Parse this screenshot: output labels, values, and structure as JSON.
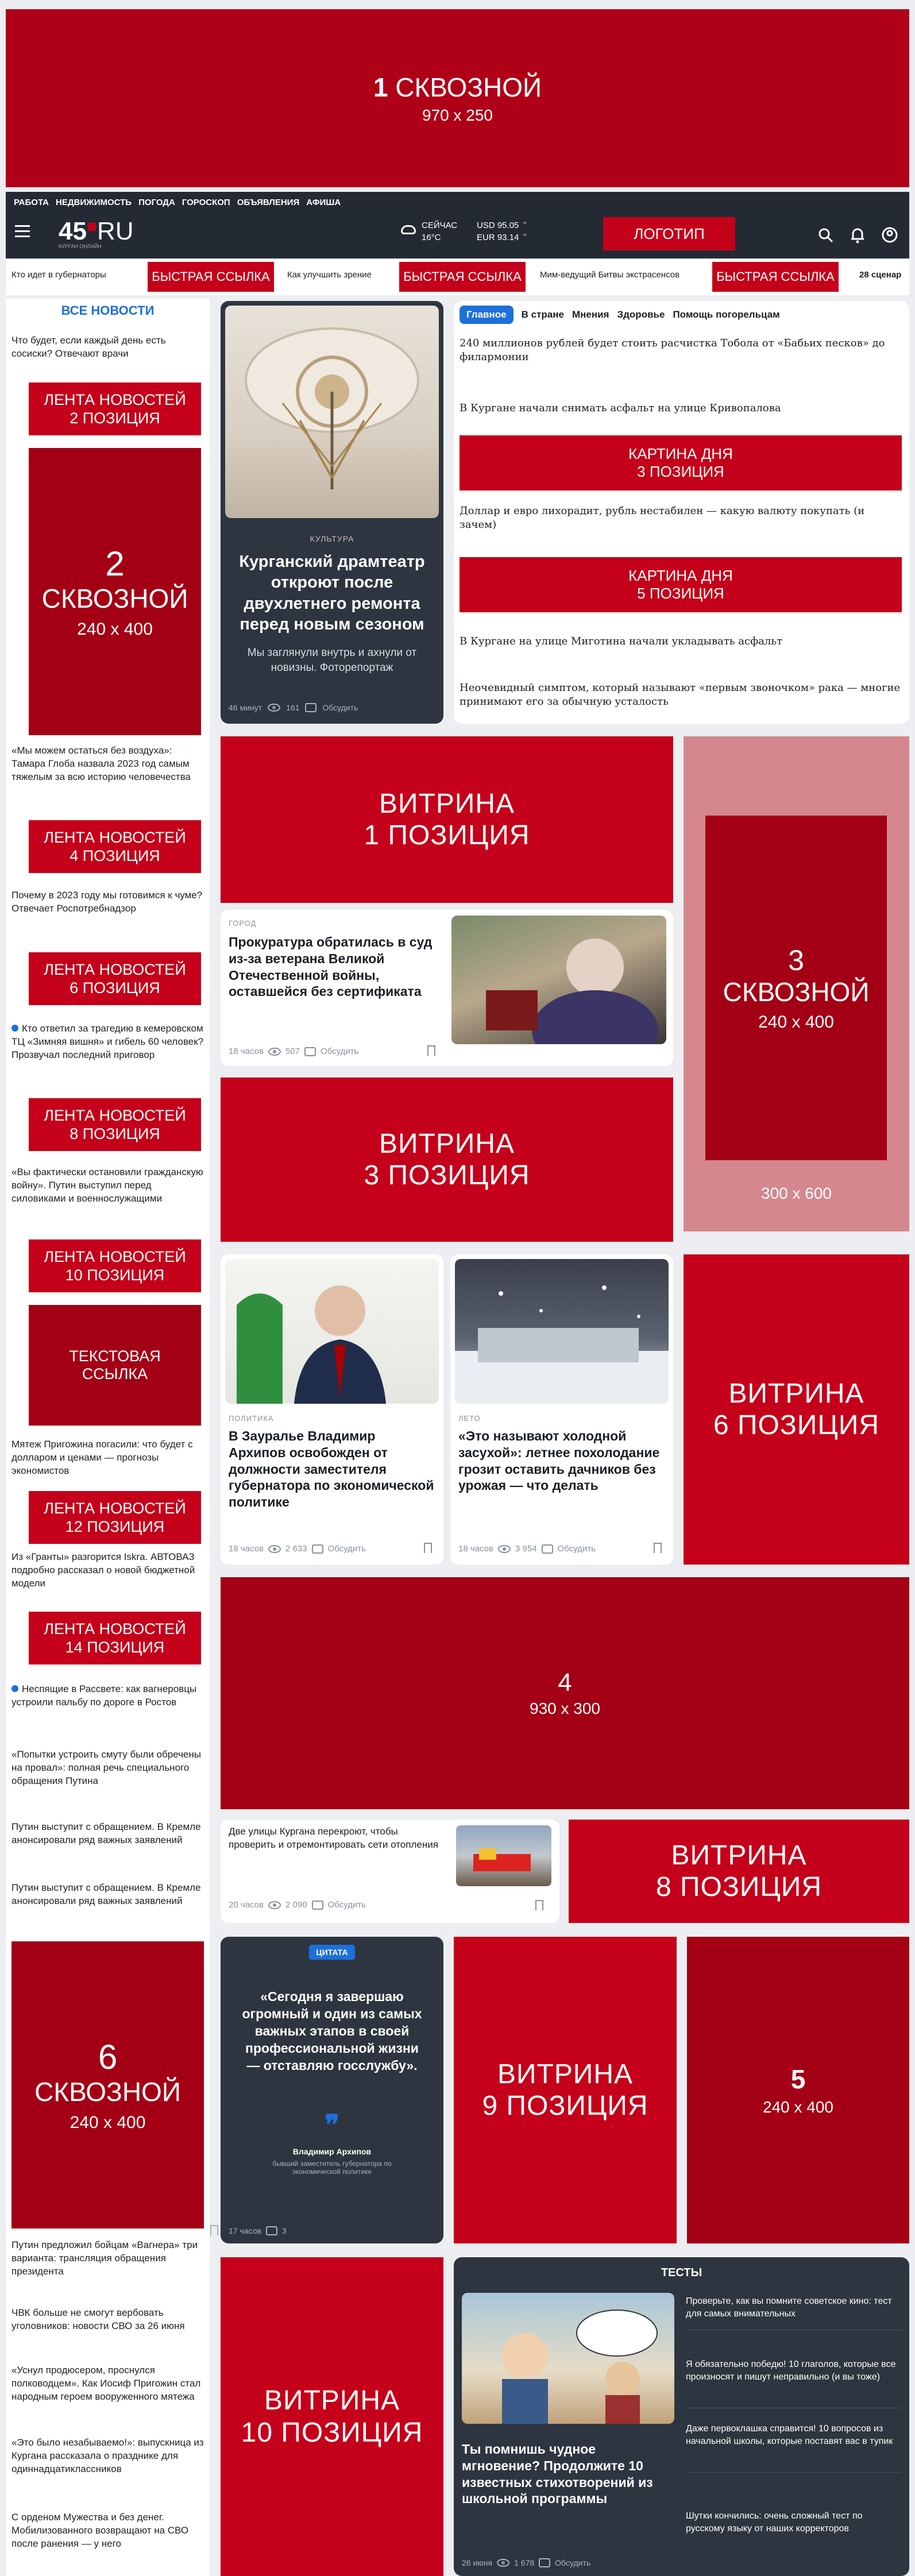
{
  "top_banner": {
    "num": "1",
    "label": "СКВОЗНОЙ",
    "size": "970 x 250"
  },
  "topnav": {
    "items": [
      "РАБОТА",
      "НЕДВИЖИМОСТЬ",
      "ПОГОДА",
      "ГОРОСКОП",
      "ОБЪЯВЛЕНИЯ",
      "АФИША"
    ]
  },
  "header": {
    "logo_num": "45",
    "logo_ru": "RU",
    "logo_sub": "КУРГАН ОНЛАЙН",
    "weather_label": "СЕЙЧАС",
    "weather_temp": "16°C",
    "usd": "USD 95.05",
    "eur": "EUR 93.14",
    "logo_button": "ЛОГОТИП"
  },
  "quicklinks": [
    "Кто идет в губернаторы",
    "БЫСТРАЯ ССЫЛКА",
    "Как улучшить зрение",
    "БЫСТРАЯ ССЫЛКА",
    "Мим-ведущий Битвы экстрасенсов",
    "БЫСТРАЯ ССЫЛКА",
    "28 сценар"
  ],
  "sidebar": {
    "title": "ВСЕ НОВОСТИ",
    "n1": "Что будет, если каждый день есть сосиски? Отвечают врачи",
    "b2": "ЛЕНТА НОВОСТЕЙ\n2 ПОЗИЦИЯ",
    "ad2_num": "2",
    "ad2_label": "СКВОЗНОЙ",
    "ad2_size": "240 x 400",
    "n2": "«Мы можем остаться без воздуха»: Тамара Глоба назвала 2023 год самым тяжелым за всю историю человечества",
    "b4": "ЛЕНТА НОВОСТЕЙ\n4 ПОЗИЦИЯ",
    "n3": "Почему в 2023 году мы готовимся к чуме? Отвечает Роспотребнадзор",
    "b6": "ЛЕНТА НОВОСТЕЙ\n6 ПОЗИЦИЯ",
    "n4": "Кто ответил за трагедию в кемеровском ТЦ «Зимняя вишня» и гибель 60 человек? Прозвучал последний приговор",
    "b8": "ЛЕНТА НОВОСТЕЙ\n8 ПОЗИЦИЯ",
    "n5": "«Вы фактически остановили гражданскую войну». Путин выступил перед силовиками и военнослужащими",
    "b10": "ЛЕНТА НОВОСТЕЙ\n10 ПОЗИЦИЯ",
    "text_link": "ТЕКСТОВАЯ\nССЫЛКА",
    "n6": "Мятеж Пригожина погасили: что будет с долларом и ценами — прогнозы экономистов",
    "b12": "ЛЕНТА НОВОСТЕЙ\n12 ПОЗИЦИЯ",
    "n7": "Из «Гранты» разгорится Iskra. АВТОВАЗ подробно рассказал о новой бюджетной модели",
    "b14": "ЛЕНТА НОВОСТЕЙ\n14 ПОЗИЦИЯ",
    "n8": "Неспящие в Рассвете: как вагнеровцы устроили пальбу по дороге в Ростов",
    "n9": "«Попытки устроить смуту были обречены на провал»: полная речь специального обращения Путина",
    "n10": "Путин выступит с обращением. В Кремле анонсировали ряд важных заявлений",
    "n11": "Путин выступит с обращением. В Кремле анонсировали ряд важных заявлений",
    "ad6_num": "6",
    "ad6_label": "СКВОЗНОЙ",
    "ad6_size": "240 x 400",
    "n12": "Путин предложил бойцам «Вагнера» три варианта: трансляция обращения президента",
    "n13": "ЧВК больше не смогут вербовать уголовников: новости СВО за 26 июня",
    "n14": "«Уснул продюсером, проснулся полководцем». Как Иосиф Пригожин стал народным героем вооруженного мятежа",
    "n15": "«Это было незабываемо!»: выпускница из Кургана рассказала о празднике для одиннадцатиклассников",
    "n16": "С орденом Мужества и без денег. Мобилизованного возвращают на СВО после ранения — у него"
  },
  "feature": {
    "tag": "КУЛЬТУРА",
    "title": "Курганский драмтеатр откроют после двухлетнего ремонта перед новым сезоном",
    "sub": "Мы заглянули внутрь и ахнули от новизны. Фоторепортаж",
    "time": "46 минут",
    "views": "161",
    "comments": "Обсудить"
  },
  "tabs": [
    "Главное",
    "В стране",
    "Мнения",
    "Здоровье",
    "Помощь погорельцам"
  ],
  "headlines": {
    "h1": "240 миллионов рублей будет стоить расчистка Тобола от «Бабьих песков» до филармонии",
    "h2": "В Кургане начали снимать асфальт на улице Кривопалова",
    "kd3": "КАРТИНА ДНЯ\n3 ПОЗИЦИЯ",
    "h3": "Доллар и евро лихорадит, рубль нестабилен — какую валюту покупать (и зачем)",
    "kd5": "КАРТИНА ДНЯ\n5 ПОЗИЦИЯ",
    "h4": "В Кургане на улице Миготина начали укладывать асфальт",
    "h5": "Неочевидный симптом, который называют «первым звоночком» рака — многие принимают его за обычную усталость"
  },
  "vitrina1": "ВИТРИНА\n1 ПОЗИЦИЯ",
  "ad3": {
    "num": "3",
    "label": "СКВОЗНОЙ",
    "size": "240 x 400",
    "outer": "300 x 600"
  },
  "story1": {
    "tag": "ГОРОД",
    "title": "Прокуратура обратилась в суд из-за ветерана Великой Отечественной войны, оставшейся без сертификата",
    "time": "18 часов",
    "views": "507",
    "comments": "Обсудить"
  },
  "vitrina3": "ВИТРИНА\n3 ПОЗИЦИЯ",
  "story2": {
    "tag": "ПОЛИТИКА",
    "title": "В Зауралье Владимир Архипов освобожден от должности заместителя губернатора по экономической политике",
    "time": "18 часов",
    "views": "2 633",
    "comments": "Обсудить"
  },
  "story3": {
    "tag": "ЛЕТО",
    "title": "«Это называют холодной засухой»: летнее похолодание грозит оставить дачников без урожая — что делать",
    "time": "18 часов",
    "views": "3 954",
    "comments": "Обсудить"
  },
  "vitrina6": "ВИТРИНА\n6 ПОЗИЦИЯ",
  "ad4": {
    "num": "4",
    "size": "930 x 300"
  },
  "story4": {
    "title": "Две улицы Кургана перекроют, чтобы проверить и отремонтировать сети отопления",
    "time": "20 часов",
    "views": "2 090",
    "comments": "Обсудить"
  },
  "vitrina8": "ВИТРИНА\n8 ПОЗИЦИЯ",
  "quote": {
    "label": "ЦИТАТА",
    "text": "«Сегодня я завершаю огромный и один из самых важных этапов в своей профессиональной жизни — отставляю госслужбу».",
    "author": "Владимир Архипов",
    "role": "бывший заместитель губернатора по экономической политике",
    "time": "17 часов",
    "comments": "3"
  },
  "vitrina9": "ВИТРИНА\n9 ПОЗИЦИЯ",
  "ad5": {
    "num": "5",
    "size": "240 x 400"
  },
  "vitrina10": "ВИТРИНА\n10 ПОЗИЦИЯ",
  "tests": {
    "title": "ТЕСТЫ",
    "main_title": "Ты помнишь чудное мгновение? Продолжите 10 известных стихотворений из школьной программы",
    "time": "26 июня",
    "views": "1 678",
    "comments": "Обсудить",
    "items": [
      "Проверьте, как вы помните советское кино: тест для самых внимательных",
      "Я обязательно победю! 10 глаголов, которые все произносят и пишут неправильно (и вы тоже)",
      "Даже первоклашка справится! 10 вопросов из начальной школы, которые поставят вас в тупик",
      "Шутки кончились: очень сложный тест по русскому языку от наших корректоров"
    ]
  },
  "colors": {
    "accent": "#c4001a",
    "dark_red": "#a30015",
    "pink": "#d4878d",
    "header": "#242a33",
    "tab_active": "#1e6fd9"
  }
}
